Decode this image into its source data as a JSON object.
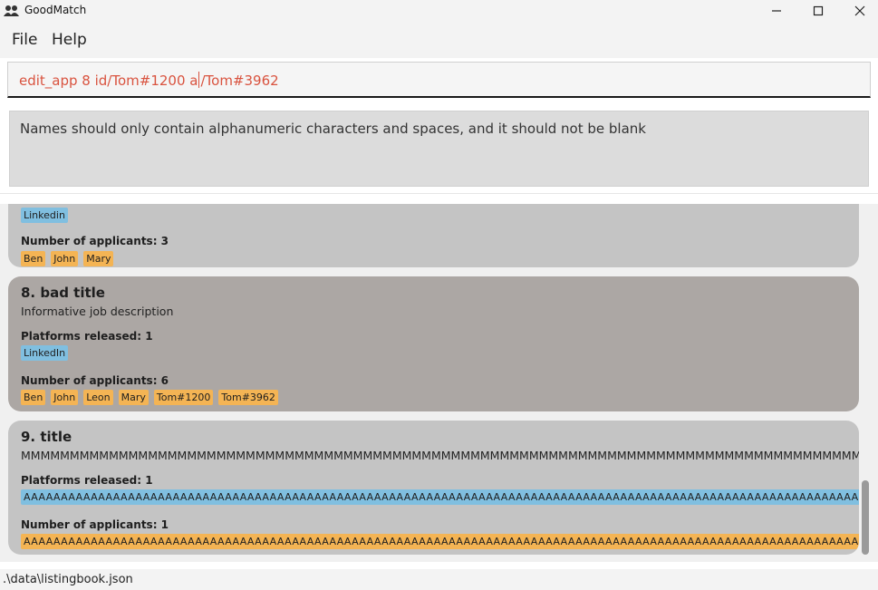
{
  "window": {
    "title": "GoodMatch",
    "minimize_glyph": "—",
    "maximize_glyph": "☐",
    "close_glyph": "✕"
  },
  "menu": {
    "file": "File",
    "help": "Help"
  },
  "command": {
    "text_before_caret": "edit_app 8 id/Tom#1200 a",
    "text_after_caret": "/Tom#3962"
  },
  "result": {
    "message": "Names should only contain alphanumeric characters and spaces, and it should not be blank"
  },
  "listings": [
    {
      "platform_tags": [
        "Linkedin"
      ],
      "applicants_label": "Number of applicants: 3",
      "applicant_tags": [
        "Ben",
        "John",
        "Mary"
      ]
    },
    {
      "title": "8.  bad title",
      "description": "Informative job description",
      "platforms_label": "Platforms released: 1",
      "platform_tags": [
        "LinkedIn"
      ],
      "applicants_label": "Number of applicants: 6",
      "applicant_tags": [
        "Ben",
        "John",
        "Leon",
        "Mary",
        "Tom#1200",
        "Tom#3962"
      ]
    },
    {
      "title": "9.  title",
      "description": "MMMMMMMMMMMMMMMMMMMMMMMMMMMMMMMMMMMMMMMMMMMMMMMMMMMMMMMMMMMMMMMMMMMMMMMMMMMMMMMMMMMMMMMMMMMMMMMMMMMMMMMMMMM",
      "platforms_label": "Platforms released: 1",
      "platform_tags": [
        "AAAAAAAAAAAAAAAAAAAAAAAAAAAAAAAAAAAAAAAAAAAAAAAAAAAAAAAAAAAAAAAAAAAAAAAAAAAAAAAAAAAAAAAAAAAAAAAAAAAAAAAAAAAAAAAAAAAAAAAAAAAAAAAAAAAAAAAAAAAAAAAAAAAAAAAAAAAAAAA"
      ],
      "applicants_label": "Number of applicants: 1",
      "applicant_tags": [
        "AAAAAAAAAAAAAAAAAAAAAAAAAAAAAAAAAAAAAAAAAAAAAAAAAAAAAAAAAAAAAAAAAAAAAAAAAAAAAAAAAAAAAAAAAAAAAAAAAAAAAAAAAAAAAAAAAAAAAAAAAAAAAAAAAAAAAAAAAAAAAAAAAAAAAAAAAAAAAAA"
      ]
    }
  ],
  "status": {
    "file_path": ".\\data\\listingbook.json"
  },
  "colors": {
    "command_text": "#d9533f",
    "platform_tag": "#80bfe0",
    "applicant_tag": "#f4b454",
    "selected_card": "#aca7a4",
    "card": "#c4c4c4"
  },
  "icons": {
    "app": "people-icon",
    "minimize": "minimize-icon",
    "maximize": "maximize-icon",
    "close": "close-icon"
  }
}
